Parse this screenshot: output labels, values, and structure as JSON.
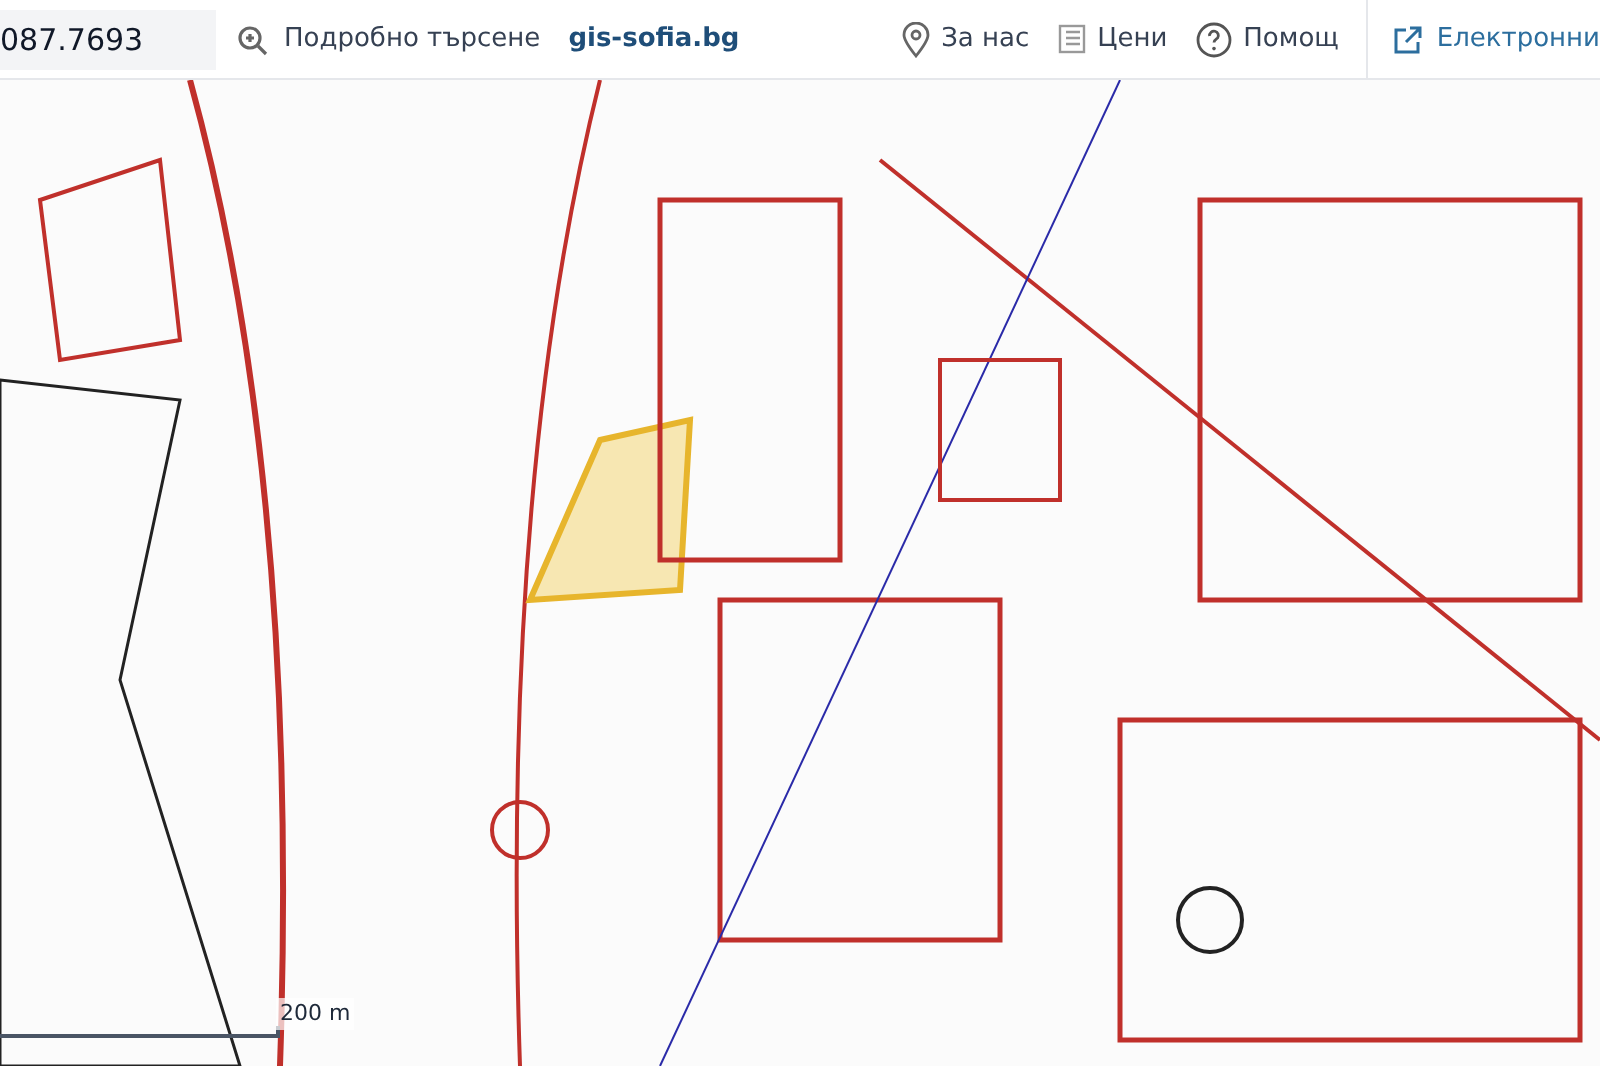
{
  "search": {
    "value": "087.7693"
  },
  "toolbar": [
    {
      "kind": "search",
      "label": "Подробно търсене"
    },
    {
      "kind": "brand",
      "label": "gis-sofia.bg"
    },
    {
      "kind": "pin",
      "label": "За нас"
    },
    {
      "kind": "list",
      "label": "Цени"
    },
    {
      "kind": "help",
      "label": "Помощ"
    },
    {
      "kind": "external",
      "label": "Електронни"
    }
  ],
  "map": {
    "kind": "picture",
    "scale": "200 m"
  }
}
